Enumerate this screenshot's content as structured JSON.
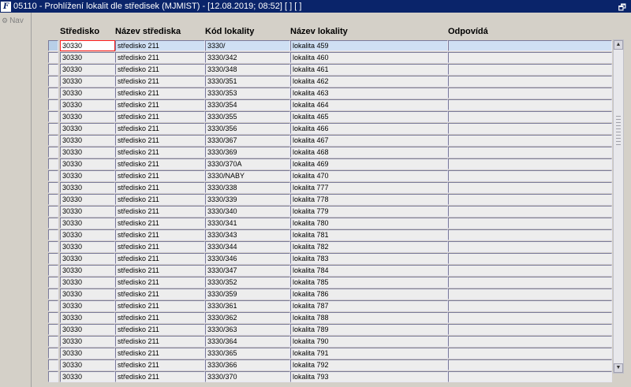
{
  "window": {
    "title": "05110 - Prohlížení lokalit dle středisek (MJMIST) - [12.08.2019; 08:52]  [ ]  [ ]",
    "app_icon": "F",
    "restore_symbol": "🗗"
  },
  "sidebar": {
    "nav_label": "Nav"
  },
  "table": {
    "columns": [
      "Středisko",
      "Název střediska",
      "Kód lokality",
      "Název lokality",
      "Odpovídá"
    ],
    "rows": [
      [
        "30330",
        "středisko 211",
        "3330/",
        "lokalita 459",
        ""
      ],
      [
        "30330",
        "středisko 211",
        "3330/342",
        "lokalita 460",
        ""
      ],
      [
        "30330",
        "středisko 211",
        "3330/348",
        "lokalita 461",
        ""
      ],
      [
        "30330",
        "středisko 211",
        "3330/351",
        "lokalita 462",
        ""
      ],
      [
        "30330",
        "středisko 211",
        "3330/353",
        "lokalita 463",
        ""
      ],
      [
        "30330",
        "středisko 211",
        "3330/354",
        "lokalita 464",
        ""
      ],
      [
        "30330",
        "středisko 211",
        "3330/355",
        "lokalita 465",
        ""
      ],
      [
        "30330",
        "středisko 211",
        "3330/356",
        "lokalita 466",
        ""
      ],
      [
        "30330",
        "středisko 211",
        "3330/367",
        "lokalita 467",
        ""
      ],
      [
        "30330",
        "středisko 211",
        "3330/369",
        "lokalita 468",
        ""
      ],
      [
        "30330",
        "středisko 211",
        "3330/370A",
        "lokalita 469",
        ""
      ],
      [
        "30330",
        "středisko 211",
        "3330/NABY",
        "lokalita 470",
        ""
      ],
      [
        "30330",
        "středisko 211",
        "3330/338",
        "lokalita 777",
        ""
      ],
      [
        "30330",
        "středisko 211",
        "3330/339",
        "lokalita 778",
        ""
      ],
      [
        "30330",
        "středisko 211",
        "3330/340",
        "lokalita 779",
        ""
      ],
      [
        "30330",
        "středisko 211",
        "3330/341",
        "lokalita 780",
        ""
      ],
      [
        "30330",
        "středisko 211",
        "3330/343",
        "lokalita 781",
        ""
      ],
      [
        "30330",
        "středisko 211",
        "3330/344",
        "lokalita 782",
        ""
      ],
      [
        "30330",
        "středisko 211",
        "3330/346",
        "lokalita 783",
        ""
      ],
      [
        "30330",
        "středisko 211",
        "3330/347",
        "lokalita 784",
        ""
      ],
      [
        "30330",
        "středisko 211",
        "3330/352",
        "lokalita 785",
        ""
      ],
      [
        "30330",
        "středisko 211",
        "3330/359",
        "lokalita 786",
        ""
      ],
      [
        "30330",
        "středisko 211",
        "3330/361",
        "lokalita 787",
        ""
      ],
      [
        "30330",
        "středisko 211",
        "3330/362",
        "lokalita 788",
        ""
      ],
      [
        "30330",
        "středisko 211",
        "3330/363",
        "lokalita 789",
        ""
      ],
      [
        "30330",
        "středisko 211",
        "3330/364",
        "lokalita 790",
        ""
      ],
      [
        "30330",
        "středisko 211",
        "3330/365",
        "lokalita 791",
        ""
      ],
      [
        "30330",
        "středisko 211",
        "3330/366",
        "lokalita 792",
        ""
      ],
      [
        "30330",
        "středisko 211",
        "3330/370",
        "lokalita 793",
        ""
      ]
    ],
    "current_row": 0
  },
  "scrollbar": {
    "up_symbol": "▲",
    "down_symbol": "▼"
  },
  "colors": {
    "titlebar": "#0a246a",
    "background": "#d4d0c8",
    "current_row": "#cfe0f4",
    "focus_border": "#ff2020"
  }
}
